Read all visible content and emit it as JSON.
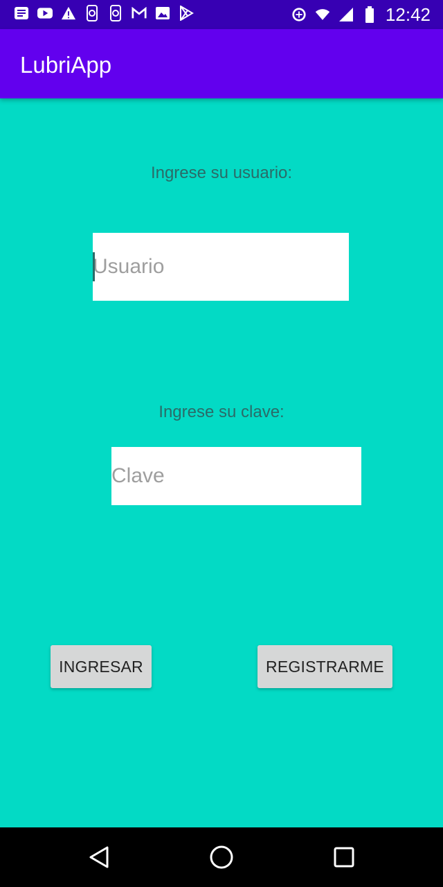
{
  "status_bar": {
    "time": "12:42",
    "icons": [
      "notification-icon",
      "youtube-icon",
      "warning-icon",
      "phone-sync-icon",
      "phone-sync-icon",
      "gmail-icon",
      "image-icon",
      "play-store-icon",
      "data-saver-icon",
      "wifi-icon",
      "signal-icon",
      "battery-icon"
    ]
  },
  "app_bar": {
    "title": "LubriApp"
  },
  "form": {
    "user_label": "Ingrese su usuario:",
    "user_placeholder": "Usuario",
    "user_value": "",
    "pass_label": "Ingrese su clave:",
    "pass_placeholder": "Clave",
    "pass_value": ""
  },
  "buttons": {
    "login": "INGRESAR",
    "register": "REGISTRARME"
  },
  "nav_bar": {
    "icons": [
      "back-icon",
      "home-icon",
      "recents-icon"
    ]
  },
  "colors": {
    "background": "#03dac5",
    "app_bar": "#6200ee",
    "status_bar": "#3700b3"
  }
}
